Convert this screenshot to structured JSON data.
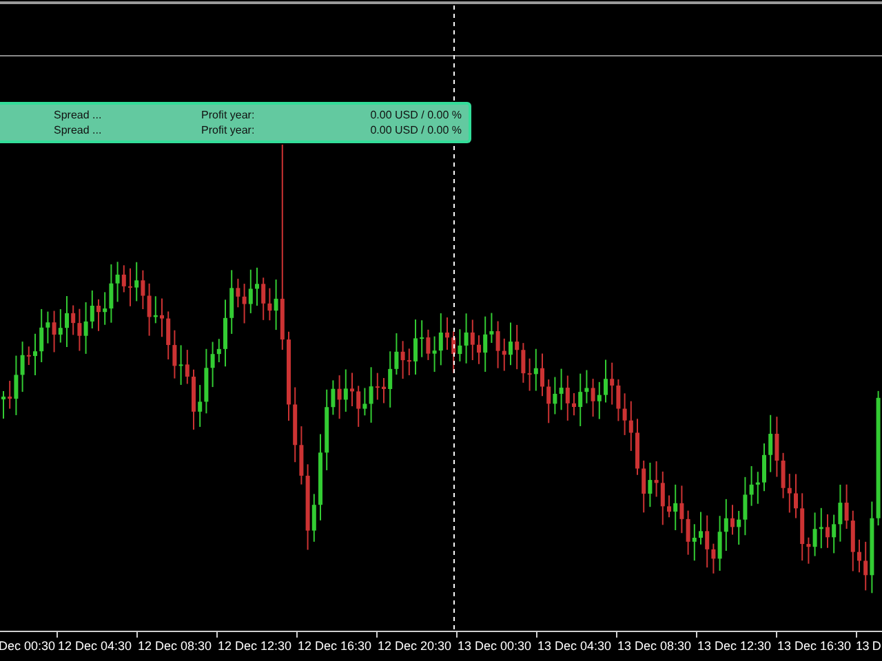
{
  "info_panel": {
    "rows": [
      {
        "label": "Spread ...",
        "metric": "Profit year:",
        "value": "0.00 USD / 0.00 %"
      },
      {
        "label": "Spread ...",
        "metric": "Profit year:",
        "value": "0.00 USD / 0.00 %"
      }
    ]
  },
  "time_axis": {
    "labels": [
      "Dec 00:30",
      "12 Dec 04:30",
      "12 Dec 08:30",
      "12 Dec 12:30",
      "12 Dec 16:30",
      "12 Dec 20:30",
      "13 Dec 00:30",
      "13 Dec 04:30",
      "13 Dec 08:30",
      "13 Dec 12:30",
      "13 Dec 16:30",
      "13 D"
    ]
  }
}
